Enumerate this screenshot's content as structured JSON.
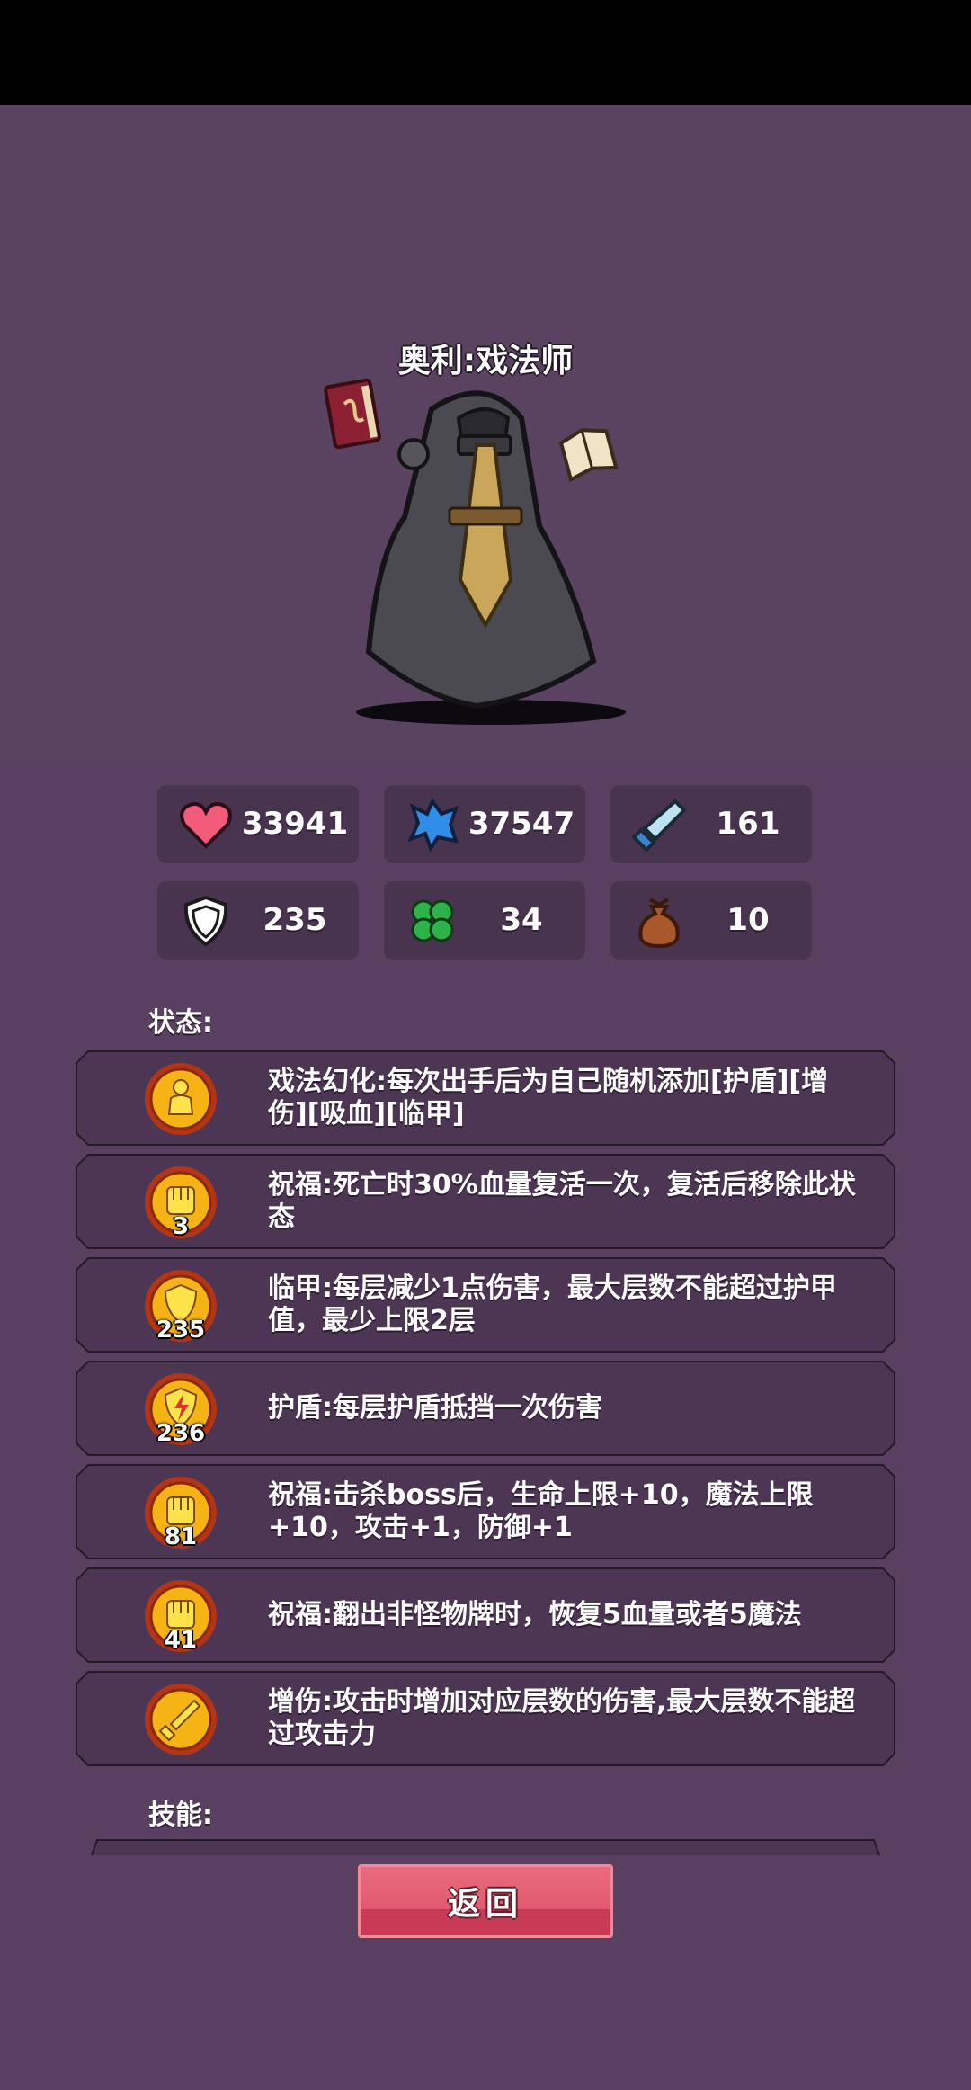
{
  "character": {
    "name": "奥利:戏法师"
  },
  "stats": [
    {
      "icon": "heart-icon",
      "value": "33941"
    },
    {
      "icon": "mana-crystal-icon",
      "value": "37547"
    },
    {
      "icon": "sword-icon",
      "value": "161"
    },
    {
      "icon": "shield-icon",
      "value": "235"
    },
    {
      "icon": "clover-icon",
      "value": "34"
    },
    {
      "icon": "money-bag-icon",
      "value": "10"
    }
  ],
  "status_section": {
    "title": "状态:"
  },
  "statuses": [
    {
      "icon": "person-icon",
      "count": "",
      "text": "戏法幻化:每次出手后为自己随机添加[护盾][增伤][吸血][临甲]"
    },
    {
      "icon": "fist-icon",
      "count": "3",
      "text": "祝福:死亡时30%血量复活一次，复活后移除此状态"
    },
    {
      "icon": "shield-icon",
      "count": "235",
      "text": "临甲:每层减少1点伤害，最大层数不能超过护甲值，最少上限2层"
    },
    {
      "icon": "lightning-shield-icon",
      "count": "236",
      "text": "护盾:每层护盾抵挡一次伤害"
    },
    {
      "icon": "fist-icon",
      "count": "81",
      "text": "祝福:击杀boss后，生命上限+10，魔法上限+10，攻击+1，防御+1"
    },
    {
      "icon": "fist-icon",
      "count": "41",
      "text": "祝福:翻出非怪物牌时，恢复5血量或者5魔法"
    },
    {
      "icon": "sword-icon",
      "count": "",
      "text": "增伤:攻击时增加对应层数的伤害,最大层数不能超过攻击力"
    }
  ],
  "skills_section": {
    "title": "技能:"
  },
  "buttons": {
    "return_label": "返回"
  },
  "colors": {
    "background": "#5a4060",
    "panel": "#493450",
    "badge_gold": "#f5b315",
    "button_red": "#e25a70"
  }
}
